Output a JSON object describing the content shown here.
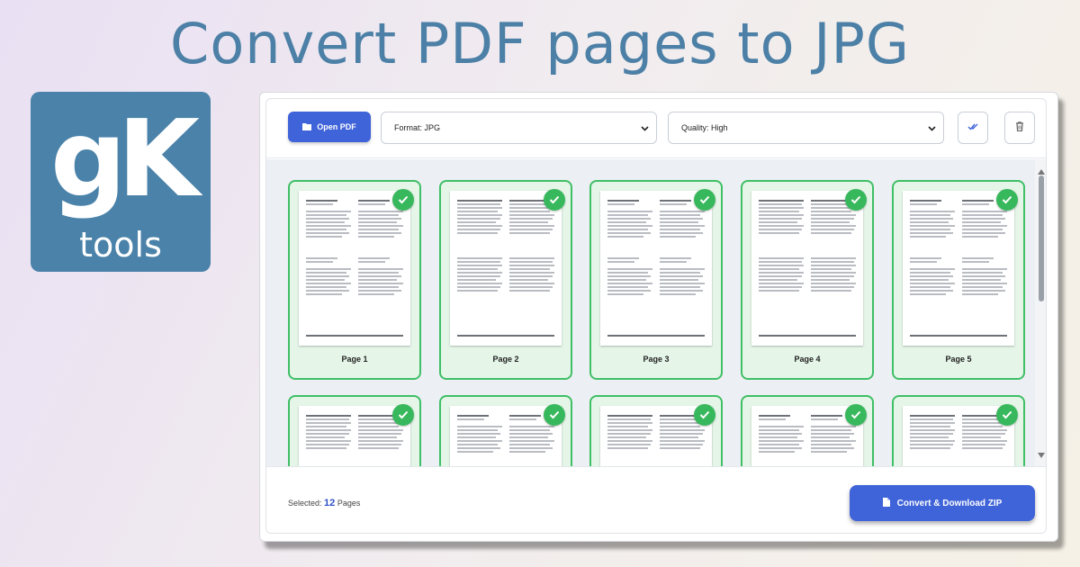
{
  "headline": "Convert PDF pages to JPG",
  "logo": {
    "mark": "gK",
    "sub": "tools"
  },
  "toolbar": {
    "open_label": "Open PDF",
    "format_label": "Format: JPG",
    "quality_label": "Quality: High"
  },
  "pages": [
    {
      "label": "Page 1",
      "selected": true
    },
    {
      "label": "Page 2",
      "selected": true
    },
    {
      "label": "Page 3",
      "selected": true
    },
    {
      "label": "Page 4",
      "selected": true
    },
    {
      "label": "Page 5",
      "selected": true
    },
    {
      "label": "",
      "selected": true
    },
    {
      "label": "",
      "selected": true
    },
    {
      "label": "",
      "selected": true
    },
    {
      "label": "",
      "selected": true
    },
    {
      "label": "",
      "selected": true
    }
  ],
  "footer": {
    "selected_prefix": "Selected:",
    "selected_count": "12",
    "selected_suffix": "Pages",
    "convert_label": "Convert & Download ZIP"
  },
  "colors": {
    "accent": "#3f63d8",
    "selected_border": "#3fbf66",
    "selected_bg": "#e5f6e9",
    "brand": "#4a82a9",
    "headline": "#4c80a6"
  },
  "icons": {
    "open": "folder-icon",
    "select_all": "double-check-icon",
    "delete": "trash-icon",
    "convert": "file-icon",
    "card_check": "check-icon"
  }
}
